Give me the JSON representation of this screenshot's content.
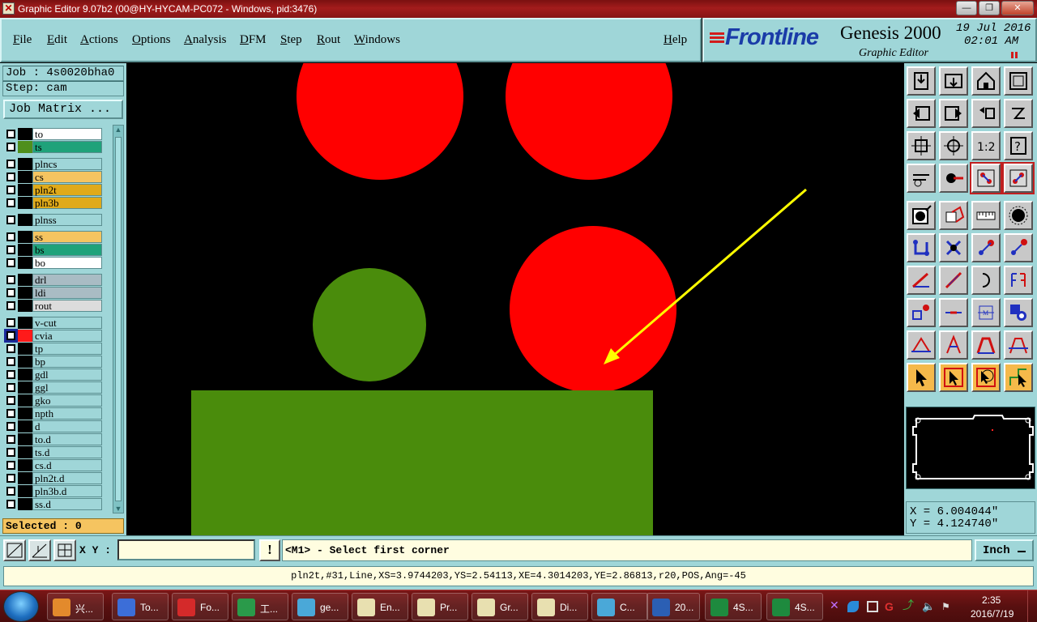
{
  "window": {
    "title": "Graphic Editor 9.07b2 (00@HY-HYCAM-PC072 - Windows, pid:3476)",
    "min_label": "—",
    "max_label": "❐",
    "close_label": "✕"
  },
  "menu": {
    "items": [
      "File",
      "Edit",
      "Actions",
      "Options",
      "Analysis",
      "DFM",
      "Step",
      "Rout",
      "Windows"
    ],
    "help": "Help"
  },
  "brand": {
    "logo": "Frontline",
    "product": "Genesis 2000",
    "subproduct": "Graphic Editor",
    "date": "19 Jul 2016",
    "time": "02:01 AM"
  },
  "job": {
    "job_label": "Job : 4s0020bha0",
    "step_label": "Step: cam",
    "matrix_button": "Job Matrix ...",
    "selected_label": "Selected : 0"
  },
  "layers": [
    {
      "name": "to",
      "color": "#ffffff",
      "swatch": "#000000",
      "state": "box"
    },
    {
      "name": "ts",
      "color": "#1fa27a",
      "swatch": "#4f8f1c",
      "state": "box"
    },
    {
      "name": "plncs",
      "color": "#9fd6d8",
      "swatch": "#000000",
      "state": "box"
    },
    {
      "name": "cs",
      "color": "#f5c460",
      "swatch": "#000000",
      "state": "box"
    },
    {
      "name": "pln2t",
      "color": "#e0aa1a",
      "swatch": "#000000",
      "state": "box"
    },
    {
      "name": "pln3b",
      "color": "#e0aa1a",
      "swatch": "#000000",
      "state": "box"
    },
    {
      "name": "plnss",
      "color": "#9fd6d8",
      "swatch": "#000000",
      "state": "box"
    },
    {
      "name": "ss",
      "color": "#f5c460",
      "swatch": "#000000",
      "state": "box"
    },
    {
      "name": "bs",
      "color": "#1fa27a",
      "swatch": "#000000",
      "state": "box"
    },
    {
      "name": "bo",
      "color": "#ffffff",
      "swatch": "#000000",
      "state": "box"
    },
    {
      "name": "drl",
      "color": "#a9bcc4",
      "swatch": "#000000",
      "state": "box"
    },
    {
      "name": "ldi",
      "color": "#a9bcc4",
      "swatch": "#000000",
      "state": "box"
    },
    {
      "name": "rout",
      "color": "#dcdcdc",
      "swatch": "#000000",
      "state": "box"
    },
    {
      "name": "v-cut",
      "color": "#9fd6d8",
      "swatch": "#000000",
      "state": "box"
    },
    {
      "name": "cvia",
      "color": "#9fd6d8",
      "swatch": "#ff1a1a",
      "state": "work"
    },
    {
      "name": "tp",
      "color": "#9fd6d8",
      "swatch": "#000000",
      "state": "box"
    },
    {
      "name": "bp",
      "color": "#9fd6d8",
      "swatch": "#000000",
      "state": "box"
    },
    {
      "name": "gdl",
      "color": "#9fd6d8",
      "swatch": "#000000",
      "state": "box"
    },
    {
      "name": "ggl",
      "color": "#9fd6d8",
      "swatch": "#000000",
      "state": "box"
    },
    {
      "name": "gko",
      "color": "#9fd6d8",
      "swatch": "#000000",
      "state": "box"
    },
    {
      "name": "npth",
      "color": "#9fd6d8",
      "swatch": "#000000",
      "state": "box"
    },
    {
      "name": "d",
      "color": "#9fd6d8",
      "swatch": "#000000",
      "state": "box"
    },
    {
      "name": "to.d",
      "color": "#9fd6d8",
      "swatch": "#000000",
      "state": "box"
    },
    {
      "name": "ts.d",
      "color": "#9fd6d8",
      "swatch": "#000000",
      "state": "box"
    },
    {
      "name": "cs.d",
      "color": "#9fd6d8",
      "swatch": "#000000",
      "state": "box"
    },
    {
      "name": "pln2t.d",
      "color": "#9fd6d8",
      "swatch": "#000000",
      "state": "box"
    },
    {
      "name": "pln3b.d",
      "color": "#9fd6d8",
      "swatch": "#000000",
      "state": "box"
    },
    {
      "name": "ss.d",
      "color": "#9fd6d8",
      "swatch": "#000000",
      "state": "box"
    }
  ],
  "canvas": {
    "pad_color": "#ff0000",
    "copper_color": "#4a8c0c",
    "line_color": "#ffff00"
  },
  "tools": [
    "snapshot-icon",
    "zoom-home-icon",
    "home-icon",
    "fit-window-icon",
    "pan-left-icon",
    "pan-right-icon",
    "undo-zoom-icon",
    "redraw-icon",
    "zoom-fit-icon",
    "zoom-center-icon",
    "scale-1-2-icon",
    "help-icon",
    "measure-tool-icon",
    "probe-icon",
    "layers-red-icon",
    "layers-red-alt-icon",
    "pad-icon",
    "rect-select-icon",
    "ruler-icon",
    "circle-pad-icon",
    "connect-nodes-icon",
    "cross-icon",
    "point-select-icon",
    "point-select-alt-icon",
    "angle-line-icon",
    "diag-line-icon",
    "arc-icon",
    "mirror-f-icon",
    "move-points-icon",
    "segment-icon",
    "width-icon",
    "pattern-icon",
    "triangle-icon",
    "polygon-up-icon",
    "poly-edit-icon",
    "poly-cut-icon",
    "select-arrow-icon",
    "select-frame-icon",
    "rotate-select-icon",
    "route-select-icon"
  ],
  "coords": {
    "x": "X =  6.004044\"",
    "y": "Y =  4.124740\""
  },
  "command": {
    "xy_label": "X Y :",
    "xy_value": "",
    "excl": "!",
    "prompt": "<M1> - Select first corner",
    "units": "Inch"
  },
  "status": "pln2t,#31,Line,XS=3.9744203,YS=2.54113,XE=4.3014203,YE=2.86813,r20,POS,Ang=-45",
  "taskbar": {
    "items": [
      {
        "label": "兴...",
        "icon": "shell-icon",
        "color": "#e38a2c"
      },
      {
        "label": "To...",
        "icon": "floppy-icon",
        "color": "#3c6ed8"
      },
      {
        "label": "Fo...",
        "icon": "refresh-icon",
        "color": "#d42a2a"
      },
      {
        "label": "工...",
        "icon": "planner-icon",
        "color": "#2a9a4a"
      },
      {
        "label": "ge...",
        "icon": "gear-cam-icon",
        "color": "#4aa8d8"
      },
      {
        "label": "En...",
        "icon": "editor-x-icon",
        "color": "#e8e0b0"
      },
      {
        "label": "Pr...",
        "icon": "editor-x-icon",
        "color": "#e8e0b0"
      },
      {
        "label": "Gr...",
        "icon": "editor-x-icon",
        "color": "#e8e0b0"
      },
      {
        "label": "Di...",
        "icon": "editor-x-icon",
        "color": "#e8e0b0"
      },
      {
        "label": "C...",
        "icon": "gear-cam-icon",
        "color": "#4aa8d8"
      },
      {
        "label": "20...",
        "icon": "word-icon",
        "color": "#2b5fb4"
      },
      {
        "label": "4S...",
        "icon": "excel-icon",
        "color": "#1e8a3e"
      },
      {
        "label": "4S...",
        "icon": "excel-icon",
        "color": "#1e8a3e"
      }
    ],
    "clock_time": "2:35",
    "clock_date": "2016/7/19"
  }
}
